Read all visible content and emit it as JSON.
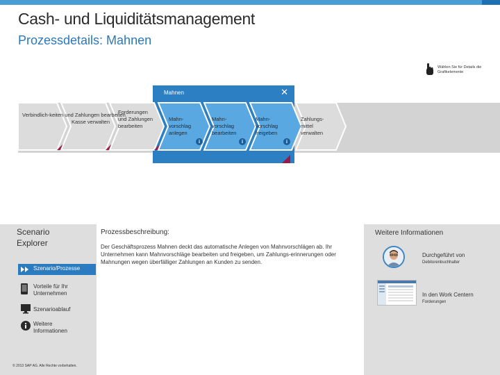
{
  "header": {
    "title": "Cash- und Liquiditätsmanagement",
    "subtitle": "Prozessdetails: Mahnen"
  },
  "hint": {
    "text": "Wählen Sie für Details die Grafikelemente"
  },
  "process": {
    "substep_group_label": "Mahnen",
    "steps": [
      {
        "label": "Verbindlich-keiten und Zahlungen bearbeiten"
      },
      {
        "label": "Kasse verwalten"
      },
      {
        "label": "Forderungen und Zahlungen bearbeiten"
      },
      {
        "label": "Mahn-vorschlag anlegen"
      },
      {
        "label": "Mahn-vorschlag bearbeiten"
      },
      {
        "label": "Mahn-vorschlag freigeben"
      },
      {
        "label": "Zahlungs-mittel verwalten"
      }
    ]
  },
  "nav": {
    "title": "Scenario Explorer",
    "active_item": "Szenario/Prozesse",
    "items": [
      {
        "label": "Vorteile für Ihr Unternehmen",
        "icon": "device-icon"
      },
      {
        "label": "Szenarioablauf",
        "icon": "monitor-icon"
      },
      {
        "label": "Weitere Informationen",
        "icon": "info-icon"
      }
    ],
    "copyright": "© 2013 SAP AG. Alle Rechte vorbehalten."
  },
  "description": {
    "title": "Prozessbeschreibung:",
    "text": "Der Geschäftsprozess Mahnen deckt das automatische Anlegen von Mahnvorschlägen ab. Ihr Unternehmen kann Mahnvorschläge bearbeiten und freigeben, um Zahlungs-erinnerungen oder Mahnungen wegen überfälliger Zahlungen an Kunden zu senden."
  },
  "more_info": {
    "title": "Weitere Informationen",
    "performed_by_label": "Durchgeführt von",
    "performed_by_value": "Debitorenbuchhalter",
    "work_center_label": "In den Work Centern",
    "work_center_value": "Forderungen"
  },
  "colors": {
    "accent_blue": "#2c7fc3",
    "light_blue": "#5aa8e2",
    "gray_chevron": "#dcdcdc",
    "magenta": "#9a1b4a"
  }
}
